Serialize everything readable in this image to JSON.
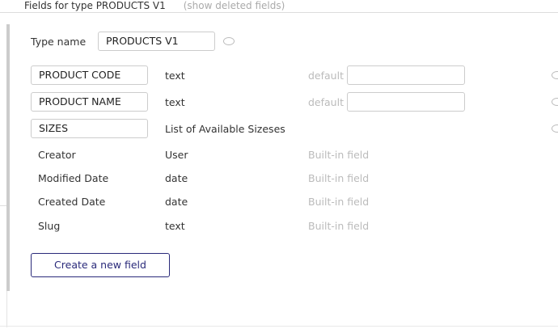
{
  "header": {
    "title": "Fields for type PRODUCTS V1",
    "show_deleted": "(show deleted fields)"
  },
  "type_name": {
    "label": "Type name",
    "value": "PRODUCTS V1"
  },
  "fields": [
    {
      "name": "PRODUCT CODE",
      "type": "text",
      "default_label": "default",
      "default_value": ""
    },
    {
      "name": "PRODUCT NAME",
      "type": "text",
      "default_label": "default",
      "default_value": ""
    },
    {
      "name": "SIZES",
      "type": "List of Available Sizeses"
    }
  ],
  "builtin": [
    {
      "name": "Creator",
      "type": "User",
      "note": "Built-in field"
    },
    {
      "name": "Modified Date",
      "type": "date",
      "note": "Built-in field"
    },
    {
      "name": "Created Date",
      "type": "date",
      "note": "Built-in field"
    },
    {
      "name": "Slug",
      "type": "text",
      "note": "Built-in field"
    }
  ],
  "create_button": "Create a new field"
}
